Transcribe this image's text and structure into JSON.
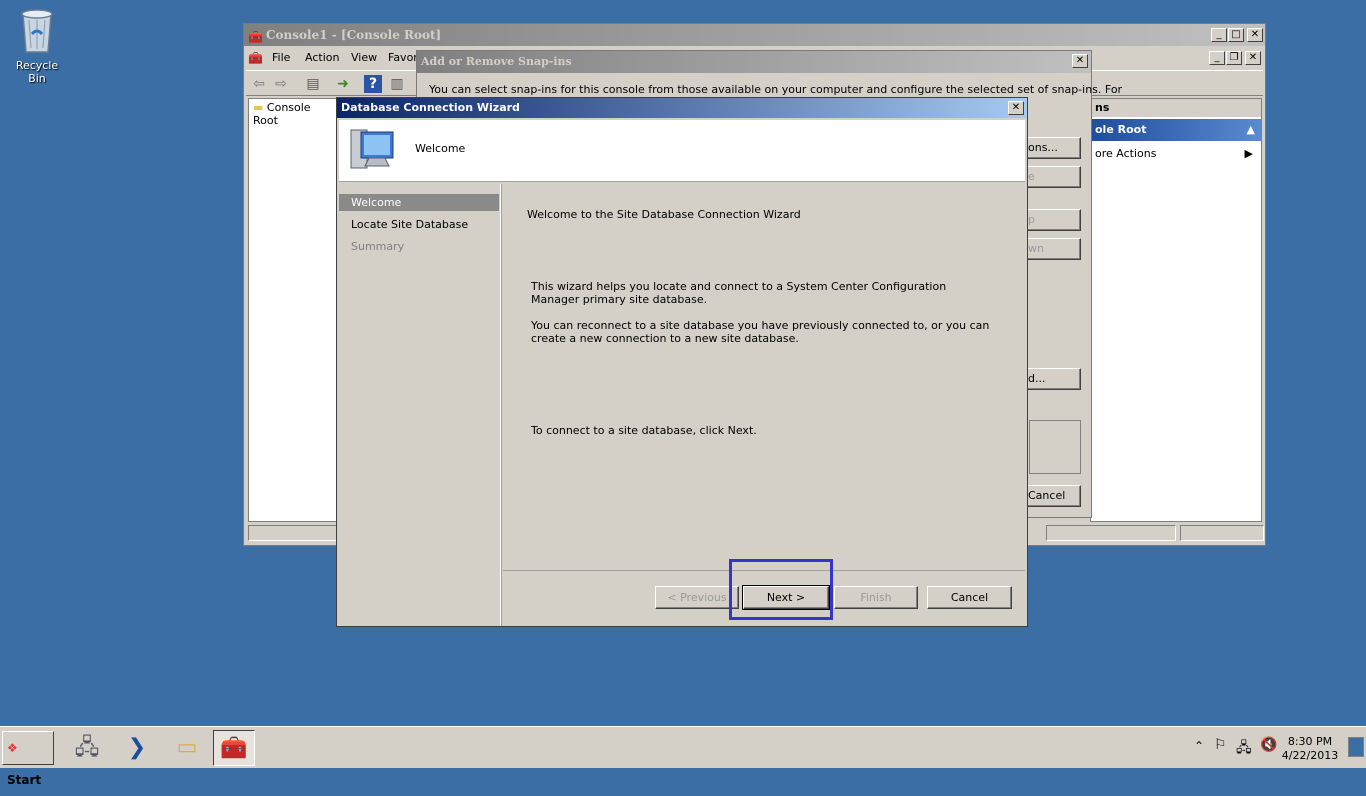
{
  "desktop": {
    "recycle_bin_label": "Recycle Bin"
  },
  "mmc": {
    "title": "Console1 - [Console Root]",
    "menu": [
      "File",
      "Action",
      "View",
      "Favor"
    ],
    "tree_item": "Console Root",
    "actions_header": "ns",
    "actions_section": "ole Root",
    "actions_more": "ore Actions"
  },
  "snapins": {
    "title": "Add or Remove Snap-ins",
    "description": "You can select snap-ins for this console from those available on your computer and configure the selected set of snap-ins. For",
    "buttons": [
      "ons...",
      "e",
      "p",
      "wn",
      "d...",
      "Cancel"
    ]
  },
  "wizard": {
    "title": "Database Connection Wizard",
    "header_title": "Welcome",
    "nav": [
      {
        "label": "Welcome"
      },
      {
        "label": "Locate Site Database"
      },
      {
        "label": "Summary"
      }
    ],
    "body": {
      "heading": "Welcome to the Site Database Connection Wizard",
      "para1": "This wizard helps you locate and connect to a System Center Configuration Manager primary site database.",
      "para2": "You can reconnect to a site database you have previously connected to, or you can create a new connection to a new site database.",
      "para3": "To connect to a site database, click Next."
    },
    "buttons": {
      "previous": "< Previous",
      "next": "Next >",
      "finish": "Finish",
      "cancel": "Cancel"
    }
  },
  "taskbar": {
    "start_label": "Start",
    "clock_time": "8:30 PM",
    "clock_date": "4/22/2013"
  },
  "colors": {
    "desktop": "#3a6ea5",
    "highlight_box": "#3535c8"
  }
}
